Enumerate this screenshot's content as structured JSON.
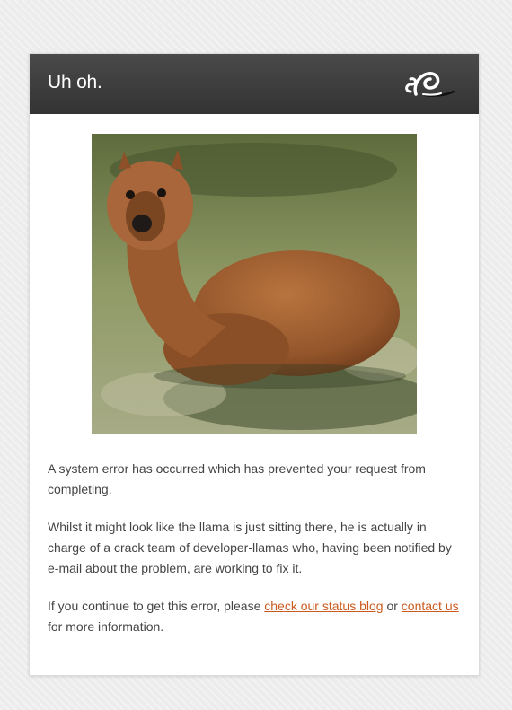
{
  "header": {
    "title": "Uh oh.",
    "logo_icon": "squarespace-logo-icon"
  },
  "image": {
    "subject": "llama-photo",
    "colors": {
      "fur": "#9a5a2e",
      "grass": "#8a9a5a",
      "shadow": "#3a4a2a"
    }
  },
  "message": {
    "p1": "A system error has occurred which has prevented your request from completing.",
    "p2": "Whilst it might look like the llama is just sitting there, he is actually in charge of a crack team of developer-llamas who, having been notified by e-mail about the problem, are working to fix it.",
    "p3_before": "If you continue to get this error, please ",
    "status_link": "check our status blog",
    "p3_middle": " or ",
    "contact_link": "contact us",
    "p3_after": " for more information."
  },
  "colors": {
    "link": "#cc5a1e",
    "header_bg": "#3b3b3b"
  }
}
